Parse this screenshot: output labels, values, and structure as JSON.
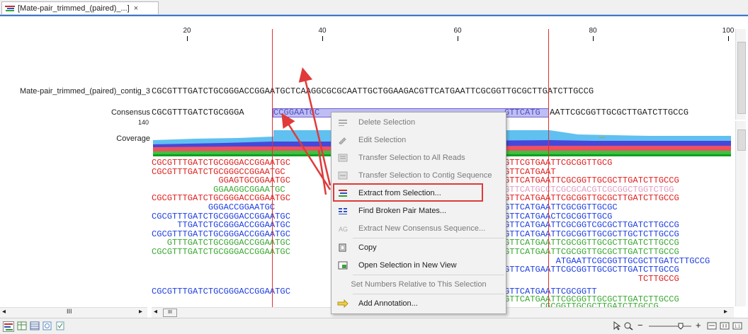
{
  "tab": {
    "title": "[Mate-pair_trimmed_(paired)_...]",
    "close": "×",
    "icon": "alignment-icon"
  },
  "ruler": {
    "ticks": [
      "20",
      "40",
      "60",
      "80",
      "100"
    ]
  },
  "rows": {
    "contig_label": "Mate-pair_trimmed_(paired)_contig_3",
    "contig_seq": "CGCGTTTGATCTGCGGGACCGGAATGCTCAAGGCGCGCAATTGCTGGAAGACGTTCATGAATTCGCGGTTGCGCTTGATCTTGCCG",
    "consensus_label": "Consensus",
    "consensus_left": "CGCGTTTGATCTGCGGGA",
    "consensus_sel": "CCGGAATGC",
    "consensus_mid": "GTTCATG",
    "consensus_right": "AATTCGCGGTTGCGCTTGATCTTGCCG",
    "consensus_number": "140",
    "coverage_label": "Coverage"
  },
  "reads_left": [
    {
      "text": "CGCGTTTGATCTGCGGGACCGGAATGC",
      "color": "#e0201e"
    },
    {
      "text": "CGCGTTTGATCTGCGGGCCGGAATGC",
      "color": "#e0201e"
    },
    {
      "text": "             GGAGTGCGGAATGC",
      "color": "#e0201e"
    },
    {
      "text": "            GGAAGGCGGAATGC",
      "color": "#3aa832"
    },
    {
      "text": "CGCGTTTGATCTGCGGGACCGGAATGC",
      "color": "#e0201e"
    },
    {
      "text": "           GGGACCGGAATGC",
      "color": "#1e3ee0"
    },
    {
      "text": "CGCGTTTGATCTGCGGGACCGGAATGC",
      "color": "#1e3ee0"
    },
    {
      "text": "     TTGATCTGCGGGACCGGAATGC",
      "color": "#1e3ee0"
    },
    {
      "text": "CGCGTTTGATCTGCGGGACCGGAATGC",
      "color": "#1e3ee0"
    },
    {
      "text": "   GTTTGATCTGCGGGACCGGAATGC",
      "color": "#3aa832"
    },
    {
      "text": "CGCGTTTGATCTGCGGGACCGGAATGC",
      "color": "#3aa832"
    }
  ],
  "reads_right": [
    {
      "text": "GTTCGTGAATTCGCGGTTGCG",
      "color": "#e0201e"
    },
    {
      "text": "GTTCATGAAT",
      "color": "#e0201e"
    },
    {
      "text": "GTTCATGAATTCGCGGTTGCGCTTGATCTTGCCG",
      "color": "#e0201e"
    },
    {
      "text": "GTTCATGCCTCGCGCACGTCGCGGCTGGTCTGG",
      "color": "#e0a0c0"
    },
    {
      "text": "GTTCATGAATTCGCGGTTGCGCTTGATCTTGCCG",
      "color": "#e0201e"
    },
    {
      "text": "GTTCATGAATTCGCGGTTGCGC",
      "color": "#1e3ee0"
    },
    {
      "text": "GTTCATGAACTCGCGGTTGCG",
      "color": "#1e3ee0"
    },
    {
      "text": "GTTCATGAATTCGCGGTCGCGCTTGATCTTGCCG",
      "color": "#1e3ee0"
    },
    {
      "text": "GTTCATGAATTCGCGGTTGCGCTTGCTCTTGCCG",
      "color": "#1e3ee0"
    },
    {
      "text": "GTTCATGAATTCGCGGTTGCGCTTGATCTTGCCG",
      "color": "#3aa832"
    },
    {
      "text": "GTTCATGAATTCGCGGTTGCGCTTGATCTTGCCG",
      "color": "#3aa832"
    },
    {
      "text": "          ATGAATTCGCGGTTGCGCTTGATCTTGCCG",
      "color": "#1e3ee0"
    },
    {
      "text": "GTTCATGAATTCGCGGTTGCGCTTGATCTTGCCG",
      "color": "#1e3ee0"
    },
    {
      "text": "                          TCTTGCCG",
      "color": "#e0201e"
    }
  ],
  "reads_bottom": [
    {
      "text": "CGCGTTTGATCTGCGGGACCGGAATGC",
      "color": "#1e3ee0",
      "right": "GTTCATGAATTCGCGGTT",
      "rcolor": "#1e3ee0"
    },
    {
      "text": "",
      "color": "#1e3ee0",
      "right": "GTTCATGAATTCGCGGTTGCGCTTGATCTTGCCG",
      "rcolor": "#3aa832"
    },
    {
      "text": "",
      "color": "#3aa832",
      "right": "       CGCGGTTGCGCTTGATCTTGCCG",
      "rcolor": "#3aa832"
    }
  ],
  "menu": {
    "items": [
      {
        "label": "Delete Selection",
        "icon": "delete-selection-icon",
        "enabled": false
      },
      {
        "label": "Edit Selection",
        "icon": "edit-selection-icon",
        "enabled": false
      },
      {
        "label": "Transfer Selection to All Reads",
        "icon": "transfer-reads-icon",
        "enabled": false
      },
      {
        "label": "Transfer Selection to Contig Sequence",
        "icon": "transfer-contig-icon",
        "enabled": false
      },
      {
        "label": "Extract from Selection...",
        "icon": "extract-selection-icon",
        "enabled": true
      },
      {
        "label": "Find Broken Pair Mates...",
        "icon": "broken-pair-icon",
        "enabled": true
      },
      {
        "label": "Extract New Consensus Sequence...",
        "icon": "consensus-icon",
        "enabled": false
      },
      {
        "label": "Copy",
        "icon": "copy-icon",
        "enabled": true
      },
      {
        "label": "Open Selection in New View",
        "icon": "new-view-icon",
        "enabled": true
      },
      {
        "label": "Set Numbers Relative to This Selection",
        "icon": "",
        "enabled": false
      },
      {
        "label": "Add Annotation...",
        "icon": "add-annotation-icon",
        "enabled": true
      }
    ]
  },
  "colors": {
    "accent": "#3b78d8",
    "selection_line": "#e03030",
    "highlight": "#e03a3a"
  },
  "scroll": {
    "h_label": "III"
  }
}
